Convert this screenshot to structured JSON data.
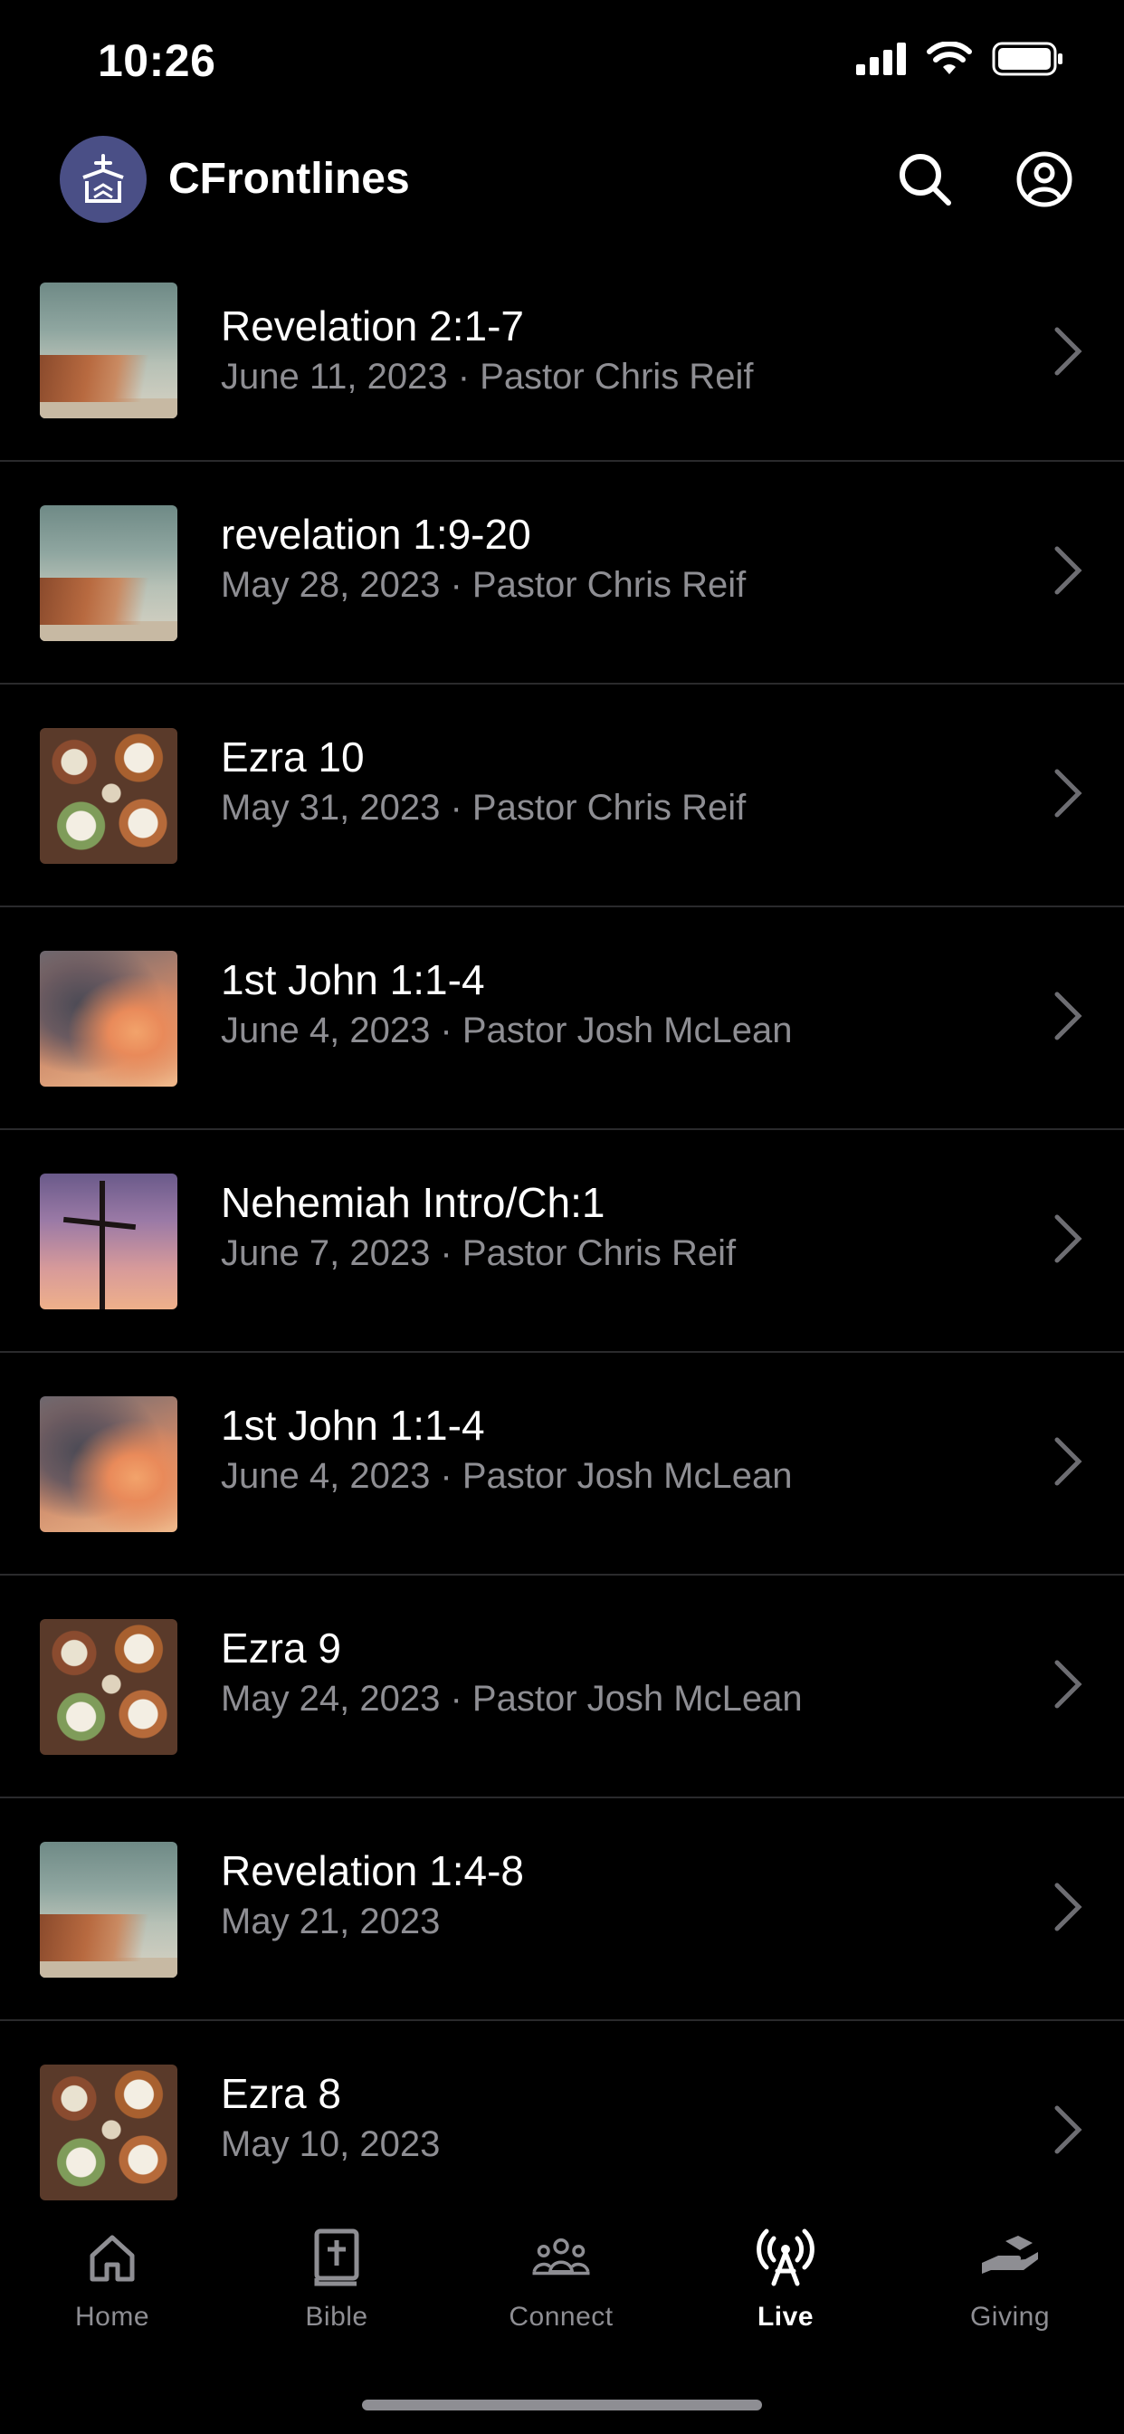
{
  "status": {
    "time": "10:26"
  },
  "header": {
    "title": "CFrontlines"
  },
  "sermons": [
    {
      "title": "Revelation 2:1-7",
      "subtitle": "June 11, 2023 · Pastor Chris Reif",
      "thumb": "hands"
    },
    {
      "title": "revelation 1:9-20",
      "subtitle": "May 28, 2023 · Pastor Chris Reif",
      "thumb": "hands"
    },
    {
      "title": "Ezra 10",
      "subtitle": "May 31, 2023 · Pastor Chris Reif",
      "thumb": "food"
    },
    {
      "title": "1st John 1:1-4",
      "subtitle": "June 4, 2023 · Pastor Josh McLean",
      "thumb": "clouds"
    },
    {
      "title": "Nehemiah Intro/Ch:1",
      "subtitle": "June 7, 2023 · Pastor Chris Reif",
      "thumb": "cross"
    },
    {
      "title": "1st John 1:1-4",
      "subtitle": "June 4, 2023 · Pastor Josh McLean",
      "thumb": "clouds"
    },
    {
      "title": "Ezra 9",
      "subtitle": "May 24, 2023 · Pastor Josh McLean",
      "thumb": "food"
    },
    {
      "title": "Revelation 1:4-8",
      "subtitle": "May 21, 2023",
      "thumb": "hands"
    },
    {
      "title": "Ezra 8",
      "subtitle": "May 10, 2023",
      "thumb": "food"
    }
  ],
  "tabs": [
    {
      "label": "Home",
      "icon": "home-icon"
    },
    {
      "label": "Bible",
      "icon": "bible-icon"
    },
    {
      "label": "Connect",
      "icon": "people-icon"
    },
    {
      "label": "Live",
      "icon": "broadcast-icon",
      "active": true
    },
    {
      "label": "Giving",
      "icon": "giving-icon"
    }
  ],
  "colors": {
    "background": "#000000",
    "secondary_text": "#8e8e93",
    "separator": "#2a2a2c",
    "logo_bg": "#4a4f86"
  }
}
